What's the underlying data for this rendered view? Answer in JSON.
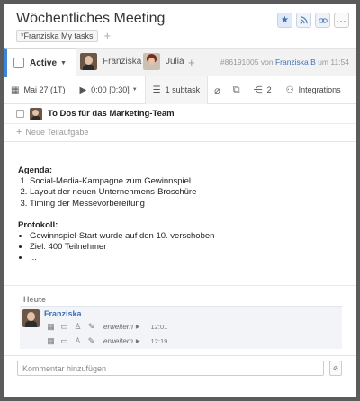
{
  "header": {
    "title": "Wöchentliches Meeting",
    "tag": "*Franziska My tasks",
    "tag_add": "+",
    "buttons": {
      "star": "★",
      "rss": "rss-icon",
      "link": "link-icon",
      "more": "···"
    }
  },
  "status": {
    "label": "Active",
    "assignees": [
      {
        "name": "Franziska"
      },
      {
        "name": "Julia"
      }
    ],
    "add": "+",
    "task_id": "#86191005",
    "by": "von",
    "author": "Franziska B",
    "time": "um 11:54"
  },
  "tools": {
    "date": "Mai 27 (1T)",
    "timer": "0:00 [0:30]",
    "subtasks": "1 subtask",
    "shares": "2",
    "integrations": "Integrations"
  },
  "subtask": {
    "title": "To Dos für das Marketing-Team",
    "new_label": "Neue Teilaufgabe"
  },
  "description": {
    "agenda_heading": "Agenda:",
    "agenda": [
      "Social-Media-Kampagne zum Gewinnspiel",
      "Layout der neuen Unternehmens-Broschüre",
      "Timing der Messevorbereitung"
    ],
    "protocol_heading": "Protokoll:",
    "protocol": [
      "Gewinnspiel-Start wurde auf den 10. verschoben",
      "Ziel: 400 Teilnehmer",
      "..."
    ]
  },
  "activity": {
    "day_label": "Heute",
    "user": "Franziska",
    "entries": [
      {
        "more": "erweitern",
        "time": "12:01"
      },
      {
        "more": "erweitern",
        "time": "12:19"
      }
    ]
  },
  "comment": {
    "placeholder": "Kommentar hinzufügen"
  }
}
